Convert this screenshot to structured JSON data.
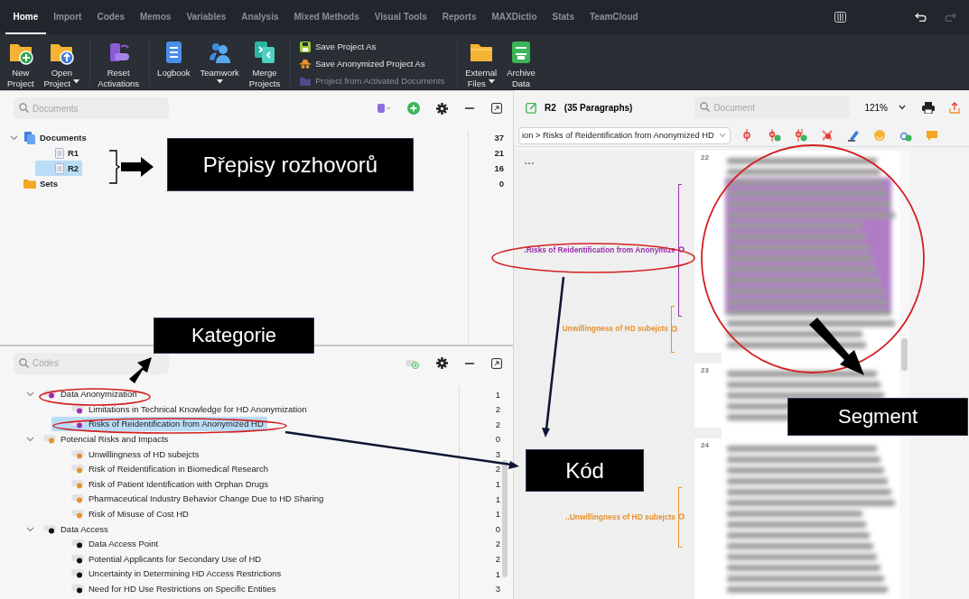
{
  "menu_tabs": [
    {
      "label": "Home",
      "selected": true
    },
    {
      "label": "Import",
      "selected": false
    },
    {
      "label": "Codes",
      "selected": false
    },
    {
      "label": "Memos",
      "selected": false
    },
    {
      "label": "Variables",
      "selected": false
    },
    {
      "label": "Analysis",
      "selected": false
    },
    {
      "label": "Mixed Methods",
      "selected": false
    },
    {
      "label": "Visual Tools",
      "selected": false
    },
    {
      "label": "Reports",
      "selected": false
    },
    {
      "label": "MAXDictio",
      "selected": false
    },
    {
      "label": "Stats",
      "selected": false
    },
    {
      "label": "TeamCloud",
      "selected": false
    }
  ],
  "ribbon": [
    {
      "kind": "button",
      "lines": [
        "New",
        "Project"
      ],
      "dropdown": false
    },
    {
      "kind": "button",
      "lines": [
        "Open",
        "Project"
      ],
      "dropdown": true
    },
    {
      "kind": "button",
      "lines": [
        "Reset",
        "Activations"
      ],
      "dropdown": false
    },
    {
      "kind": "button",
      "lines": [
        "Logbook"
      ],
      "dropdown": false
    },
    {
      "kind": "button",
      "lines": [
        "Teamwork"
      ],
      "dropdown": true
    },
    {
      "kind": "button",
      "lines": [
        "Merge",
        "Projects"
      ],
      "dropdown": false
    },
    {
      "kind": "actions",
      "items": [
        {
          "label": "Save Project As",
          "disabled": false
        },
        {
          "label": "Save Anonymized Project As",
          "disabled": false
        },
        {
          "label": "Project from Activated Documents",
          "disabled": true
        }
      ]
    },
    {
      "kind": "button",
      "lines": [
        "External",
        "Files"
      ],
      "dropdown": true
    },
    {
      "kind": "button",
      "lines": [
        "Archive",
        "Data"
      ],
      "dropdown": false
    }
  ],
  "documents": {
    "search_placeholder": "Documents",
    "items": [
      {
        "kind": "folder",
        "label": "Documents",
        "count": "37",
        "expanded": true,
        "selected": false,
        "children": [
          {
            "kind": "document",
            "label": "R1",
            "count": "21",
            "selected": false
          },
          {
            "kind": "document",
            "label": "R2",
            "count": "16",
            "selected": true
          }
        ]
      },
      {
        "kind": "set",
        "label": "Sets",
        "count": "0",
        "selected": false
      }
    ]
  },
  "codes": {
    "search_placeholder": "Codes",
    "items": [
      {
        "label": "Data Anonymization",
        "count": "1",
        "color": "#9b2fae",
        "expanded": true,
        "selected": false,
        "children": [
          {
            "label": "Limitations in Technical Knowledge for HD Anonymization",
            "count": "2",
            "color": "#9b2fae",
            "selected": false
          },
          {
            "label": "Risks of Reidentification from Anonymized HD",
            "count": "2",
            "color": "#9b2fae",
            "selected": true
          }
        ]
      },
      {
        "label": "Potencial Risks and Impacts",
        "count": "0",
        "color": "#e8912d",
        "expanded": true,
        "selected": false,
        "children": [
          {
            "label": "Unwillingness of HD subejcts",
            "count": "3",
            "color": "#e8912d",
            "selected": false
          },
          {
            "label": "Risk of Reidentification in Biomedical Research",
            "count": "2",
            "color": "#e8912d",
            "selected": false
          },
          {
            "label": "Risk of Patient Identification with Orphan Drugs",
            "count": "1",
            "color": "#e8912d",
            "selected": false
          },
          {
            "label": "Pharmaceutical Industry Behavior Change Due to HD Sharing",
            "count": "1",
            "color": "#e8912d",
            "selected": false
          },
          {
            "label": "Risk of Misuse of Cost HD",
            "count": "1",
            "color": "#e8912d",
            "selected": false
          }
        ]
      },
      {
        "label": "Data Access",
        "count": "0",
        "color": "#111111",
        "expanded": true,
        "selected": false,
        "children": [
          {
            "label": "Data Access Point",
            "count": "2",
            "color": "#111111",
            "selected": false
          },
          {
            "label": "Potential Applicants for Secondary Use of HD",
            "count": "2",
            "color": "#111111",
            "selected": false
          },
          {
            "label": "Uncertainty in Determining HD Access Restrictions",
            "count": "1",
            "color": "#111111",
            "selected": false
          },
          {
            "label": "Need for HD Use Restrictions on Specific Entities",
            "count": "3",
            "color": "#111111",
            "selected": false
          }
        ]
      }
    ]
  },
  "document_viewer": {
    "title": "R2",
    "paragraph_count": "(35 Paragraphs)",
    "search_placeholder": "Document",
    "zoom": "121%",
    "breadcrumb": "ion > Risks of Reidentification from Anonymized HD",
    "more": "...",
    "paragraphs": [
      {
        "number": "22"
      },
      {
        "number": "23"
      },
      {
        "number": "24"
      }
    ],
    "code_stripes": [
      {
        "label": ".Risks of Reidentification from Anonymize",
        "color": "#9b2fae"
      },
      {
        "label": "Unwillingness of HD subejcts",
        "color": "#e8912d"
      },
      {
        "label": "..Unwillingness of HD subejcts",
        "color": "#e8912d"
      }
    ]
  },
  "annotations": [
    {
      "text": "Přepisy rozhovorů"
    },
    {
      "text": "Kategorie"
    },
    {
      "text": "Segment"
    },
    {
      "text": "Kód"
    }
  ]
}
